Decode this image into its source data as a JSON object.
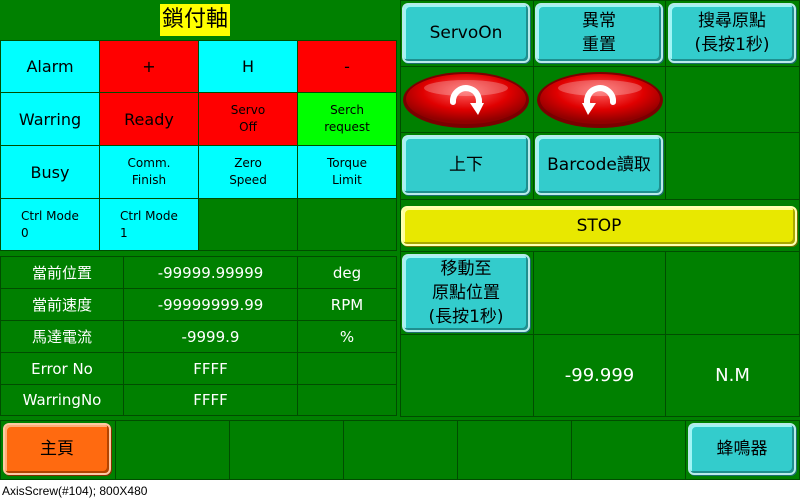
{
  "title": "鎖付軸",
  "io_grid": {
    "rows": [
      [
        "Alarm",
        "+",
        "H",
        "-"
      ],
      [
        "Warring",
        "Ready",
        "Servo\nOff",
        "Serch\nrequest"
      ],
      [
        "Busy",
        "Comm.\nFinish",
        "Zero\nSpeed",
        "Torque\nLimit"
      ],
      [
        "Ctrl Mode\n0",
        "Ctrl Mode\n1",
        "",
        ""
      ]
    ]
  },
  "info": {
    "rows": [
      {
        "label": "當前位置",
        "value": "-99999.99999",
        "unit": "deg"
      },
      {
        "label": "當前速度",
        "value": "-99999999.99",
        "unit": "RPM"
      },
      {
        "label": "馬達電流",
        "value": "-9999.9",
        "unit": "%"
      },
      {
        "label": "Error No",
        "value": "FFFF",
        "unit": ""
      },
      {
        "label": "WarringNo",
        "value": "FFFF",
        "unit": ""
      }
    ]
  },
  "buttons": {
    "servo_on": "ServoOn",
    "reset_l1": "異常",
    "reset_l2": "重置",
    "home_search_l1": "搜尋原點",
    "home_search_l2": "(長按1秒)",
    "up_down": "上下",
    "barcode": "Barcode讀取",
    "stop": "STOP",
    "move_home_l1": "移動至",
    "move_home_l2": "原點位置",
    "move_home_l3": "(長按1秒)",
    "main_page": "主頁",
    "buzzer": "蜂鳴器"
  },
  "torque": {
    "value": "-99.999",
    "unit": "N.M"
  },
  "status_bar": "AxisScrew(#104); 800X480",
  "colors": {
    "background": "#008000",
    "cyan": "#00ffff",
    "red": "#ff0000",
    "lime": "#00ff00",
    "button": "#33cccc",
    "orange": "#ff6a10",
    "stop_yellow": "#e8e800"
  }
}
